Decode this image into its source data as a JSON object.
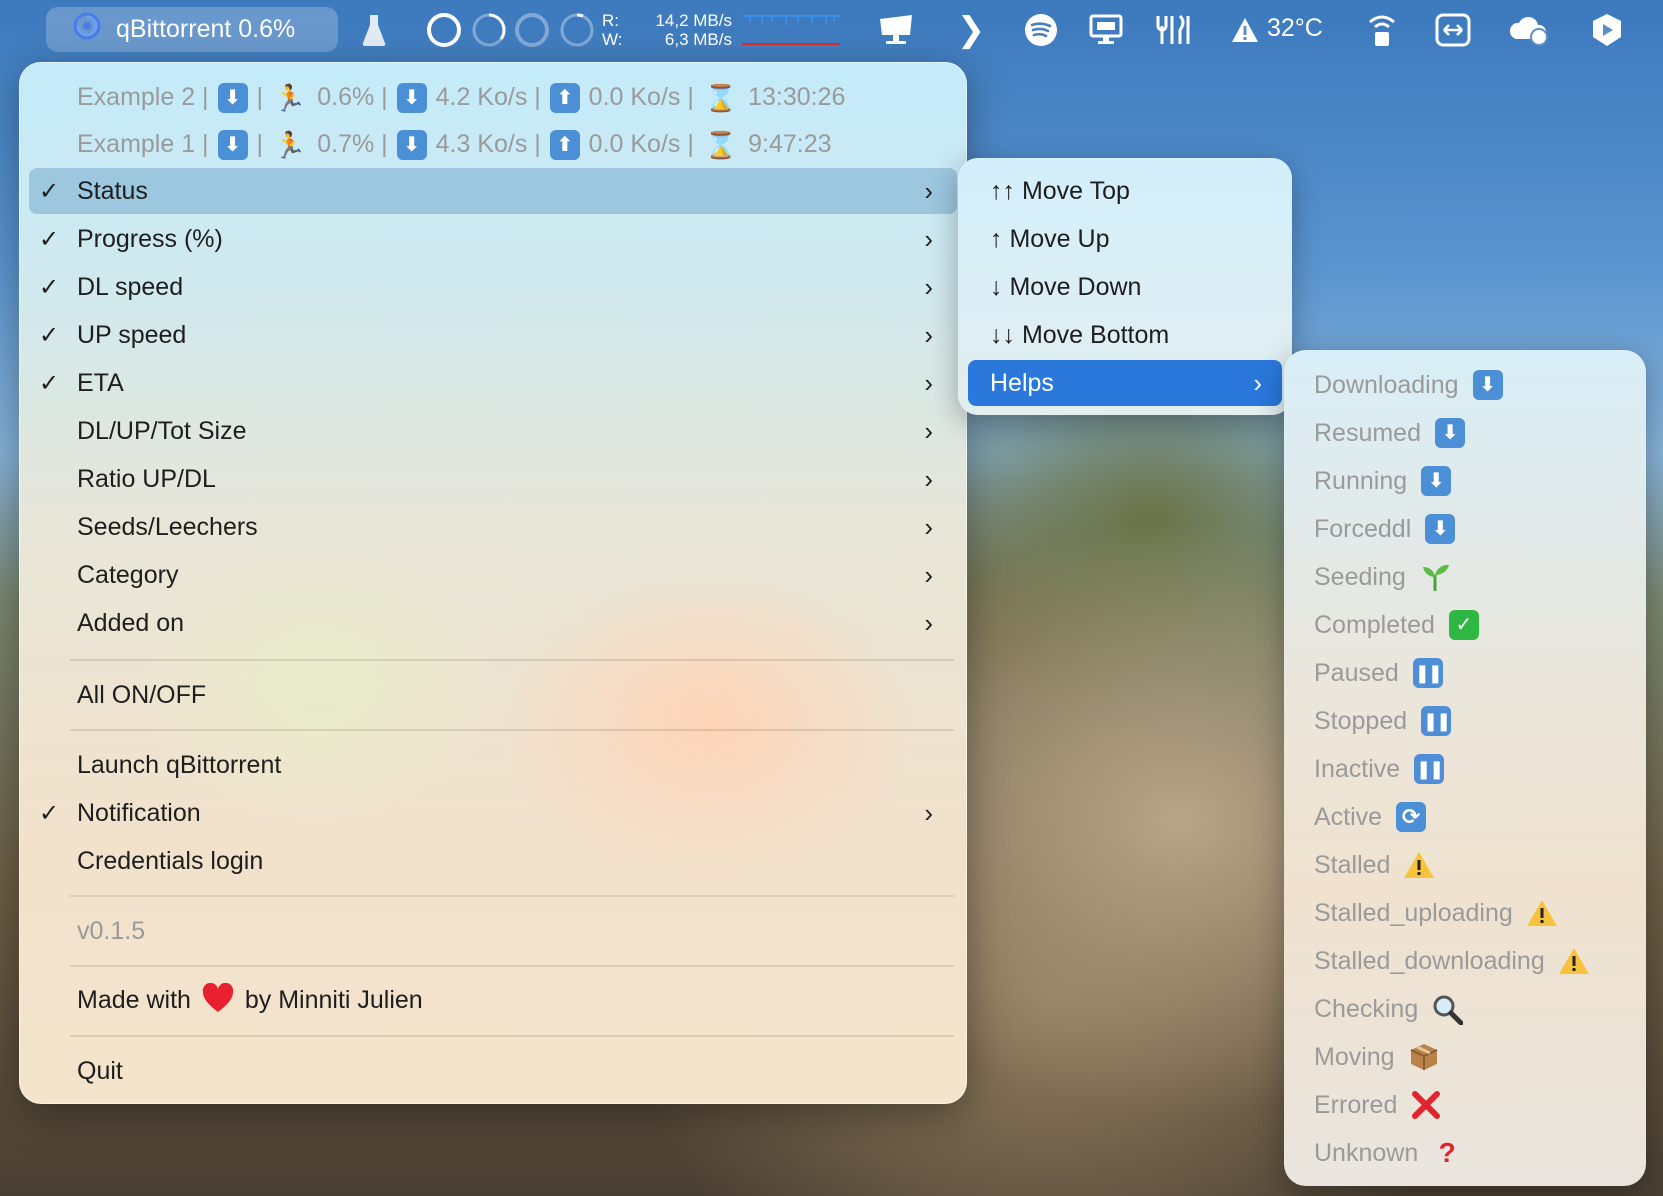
{
  "menubar": {
    "app_title": "qBittorrent 0.6%",
    "read_label": "R:",
    "write_label": "W:",
    "read_value": "14,2 MB/s",
    "write_value": "6,3 MB/s",
    "temperature": "32°C",
    "icons": [
      "qbittorrent-swirl-icon",
      "flask-icon",
      "cpu-ring-icon",
      "spinner-ring-icon",
      "ring-icon",
      "ring-icon",
      "display-stand-icon",
      "chevron-right-icon",
      "spotify-icon",
      "monitor-icon",
      "dishes-icon",
      "warning-icon",
      "wifi-lock-icon",
      "remote-arrows-icon",
      "cloud-sync-icon",
      "shield-play-icon"
    ]
  },
  "main_menu": {
    "torrents": [
      {
        "name": "Example 2 |",
        "sep1": "|",
        "progress": "0.6% |",
        "dl": "4.2 Ko/s |",
        "up": "0.0 Ko/s |",
        "eta": "13:30:26"
      },
      {
        "name": "Example 1 |",
        "sep1": "|",
        "progress": "0.7% |",
        "dl": "4.3 Ko/s |",
        "up": "0.0 Ko/s |",
        "eta": "9:47:23"
      }
    ],
    "checkmark": "✓",
    "items": [
      {
        "label": "Status",
        "checked": true,
        "submenu": true
      },
      {
        "label": "Progress (%)",
        "checked": true,
        "submenu": true
      },
      {
        "label": "DL speed",
        "checked": true,
        "submenu": true
      },
      {
        "label": "UP speed",
        "checked": true,
        "submenu": true
      },
      {
        "label": "ETA",
        "checked": true,
        "submenu": true
      },
      {
        "label": "DL/UP/Tot Size",
        "checked": false,
        "submenu": true
      },
      {
        "label": "Ratio UP/DL",
        "checked": false,
        "submenu": true
      },
      {
        "label": "Seeds/Leechers",
        "checked": false,
        "submenu": true
      },
      {
        "label": "Category",
        "checked": false,
        "submenu": true
      },
      {
        "label": "Added on",
        "checked": false,
        "submenu": true
      }
    ],
    "all_on_off": "All ON/OFF",
    "launch": "Launch qBittorrent",
    "notification": "Notification",
    "credentials": "Credentials login",
    "version": "v0.1.5",
    "made_with_prefix": "Made with",
    "made_with_suffix": "by Minniti Julien",
    "quit": "Quit",
    "chevron": "›"
  },
  "status_submenu": {
    "items": [
      "↑↑ Move Top",
      "↑ Move Up",
      "↓ Move Down",
      "↓↓ Move Bottom"
    ],
    "helps": "Helps"
  },
  "helps_submenu": {
    "items": [
      {
        "label": "Downloading",
        "icon": "download-arrow-icon"
      },
      {
        "label": "Resumed",
        "icon": "download-arrow-icon"
      },
      {
        "label": "Running",
        "icon": "download-arrow-icon"
      },
      {
        "label": "Forceddl",
        "icon": "download-arrow-icon"
      },
      {
        "label": "Seeding",
        "icon": "seedling-icon"
      },
      {
        "label": "Completed",
        "icon": "check-box-icon"
      },
      {
        "label": "Paused",
        "icon": "pause-icon"
      },
      {
        "label": "Stopped",
        "icon": "pause-icon"
      },
      {
        "label": "Inactive",
        "icon": "pause-icon"
      },
      {
        "label": "Active",
        "icon": "sync-icon"
      },
      {
        "label": "Stalled",
        "icon": "warning-icon"
      },
      {
        "label": "Stalled_uploading",
        "icon": "warning-icon"
      },
      {
        "label": "Stalled_downloading",
        "icon": "warning-icon"
      },
      {
        "label": "Checking",
        "icon": "magnifier-icon"
      },
      {
        "label": "Moving",
        "icon": "package-icon"
      },
      {
        "label": "Errored",
        "icon": "cross-icon"
      },
      {
        "label": "Unknown",
        "icon": "question-icon"
      }
    ]
  },
  "colors": {
    "selection": "#2a78dc",
    "highlight": "#76aacd",
    "icon_blue": "#4b8fd6",
    "heart": "#e8202f"
  }
}
